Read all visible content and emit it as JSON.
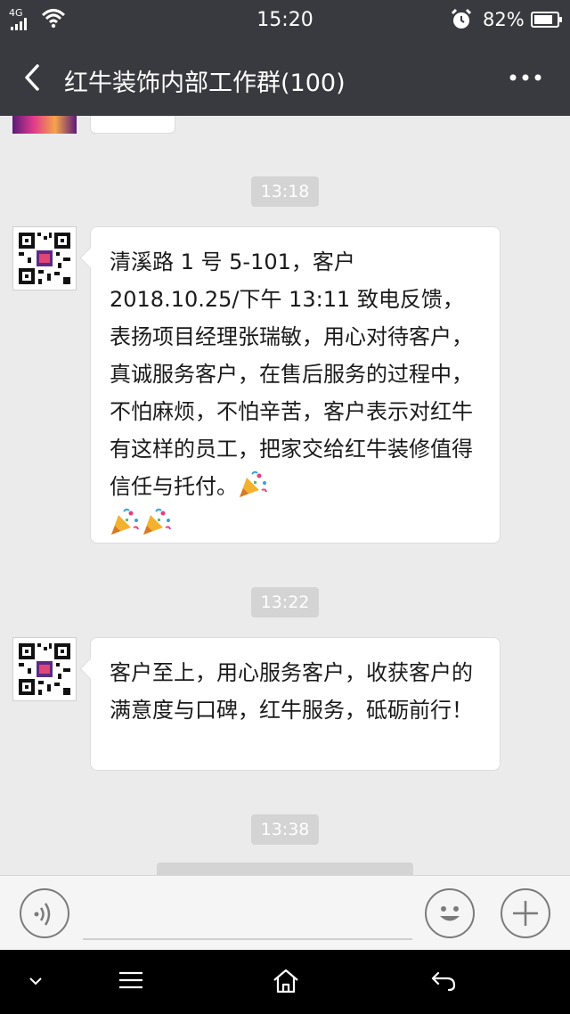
{
  "status_bar": {
    "network": "4G",
    "time": "15:20",
    "battery_percent": "82%",
    "battery_level": 0.82
  },
  "header": {
    "title": "红牛装饰内部工作群(100)"
  },
  "messages": [
    {
      "timestamp": "13:18",
      "text": "清溪路 1 号 5-101，客户 2018.10.25/下午 13:11 致电反馈，表扬项目经理张瑞敏，用心对待客户，真诚服务客户，在售后服务的过程中，不怕麻烦，不怕辛苦，客户表示对红牛有这样的员工，把家交给红牛装修值得信任与托付。",
      "emoji": [
        "party-popper-icon",
        "party-popper-icon",
        "party-popper-icon"
      ]
    },
    {
      "timestamp": "13:22",
      "text": "客户至上，用心服务客户，收获客户的满意度与口碑，红牛服务，砥砺前行！"
    },
    {
      "timestamp": "13:38"
    }
  ],
  "colors": {
    "header_bg": "#393a3f",
    "chat_bg": "#ebebeb",
    "timestamp_bg": "#d4d4d4",
    "bubble_bg": "#ffffff"
  }
}
